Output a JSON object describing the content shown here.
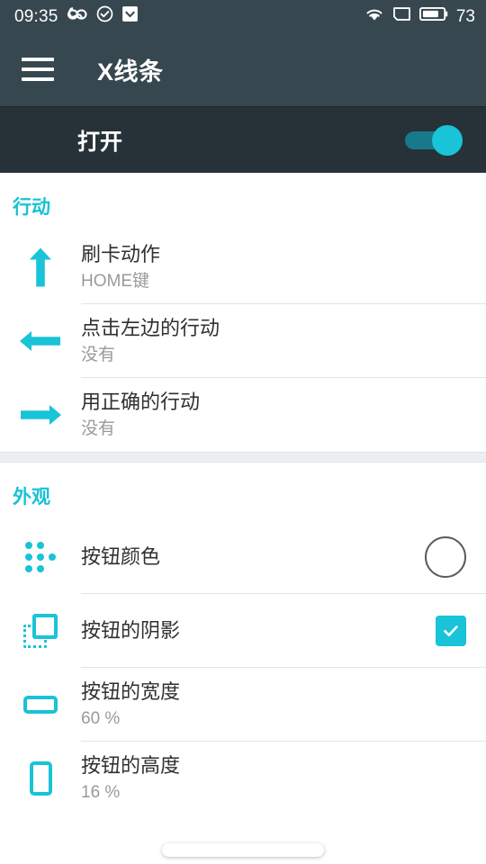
{
  "status_bar": {
    "time": "09:35",
    "battery_level": "73",
    "icons": [
      "infinity-icon",
      "check-circle-icon",
      "download-box-icon",
      "wifi-icon",
      "sim-card-icon",
      "battery-icon"
    ]
  },
  "app_bar": {
    "menu_icon": "hamburger-menu-icon",
    "title": "X线条"
  },
  "master_switch": {
    "label": "打开",
    "enabled": true,
    "accent_color": "#19c3d8",
    "background_color": "#263238"
  },
  "sections": [
    {
      "header": "行动",
      "rows": [
        {
          "icon": "arrow-up-icon",
          "title": "刷卡动作",
          "subtitle": "HOME键",
          "accessory": "none"
        },
        {
          "icon": "arrow-left-icon",
          "title": "点击左边的行动",
          "subtitle": "没有",
          "accessory": "none"
        },
        {
          "icon": "arrow-right-icon",
          "title": "用正确的行动",
          "subtitle": "没有",
          "accessory": "none"
        }
      ]
    },
    {
      "header": "外观",
      "rows": [
        {
          "icon": "color-dots-icon",
          "title": "按钮颜色",
          "subtitle": "",
          "accessory": "color-swatch",
          "swatch_color": "#ffffff"
        },
        {
          "icon": "shadow-square-icon",
          "title": "按钮的阴影",
          "subtitle": "",
          "accessory": "checkbox",
          "checked": true
        },
        {
          "icon": "rect-wide-icon",
          "title": "按钮的宽度",
          "subtitle": "60 %",
          "accessory": "none"
        },
        {
          "icon": "rect-tall-icon",
          "title": "按钮的高度",
          "subtitle": "16 %",
          "accessory": "none"
        }
      ]
    }
  ],
  "colors": {
    "accent": "#19c3d8",
    "app_bar": "#37474f",
    "master_bar": "#263238",
    "title_text": "#303030",
    "subtitle_text": "#9a9a9a"
  },
  "nav_pill": "gesture-home-pill"
}
